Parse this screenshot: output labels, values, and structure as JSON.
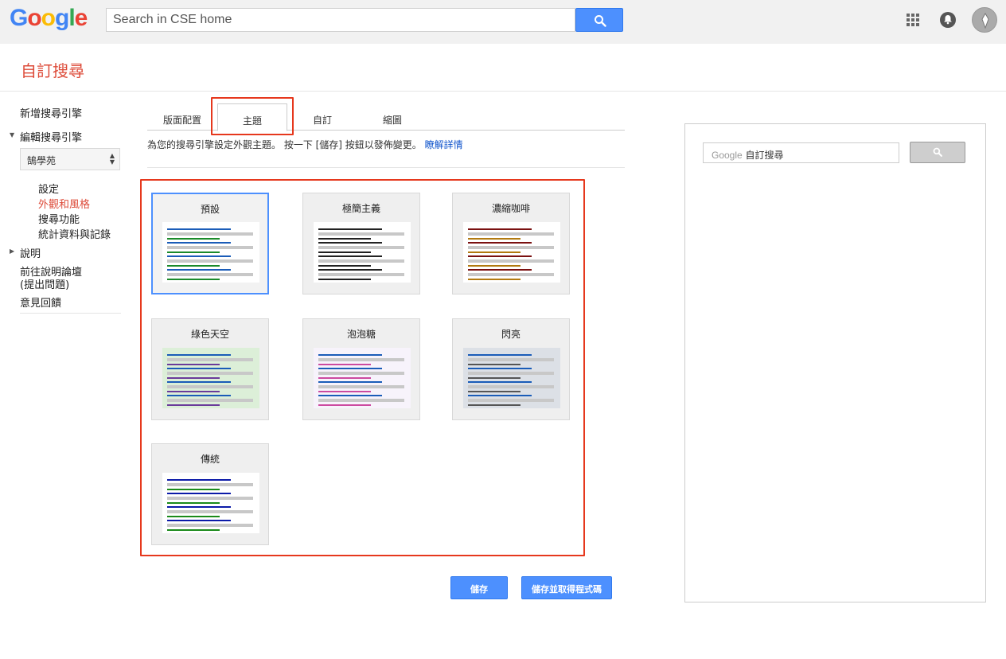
{
  "header": {
    "logo": [
      "G",
      "o",
      "o",
      "g",
      "l",
      "e"
    ],
    "logo_colors": [
      "#4285f4",
      "#ea4335",
      "#fbbc05",
      "#4285f4",
      "#34a853",
      "#ea4335"
    ],
    "search_value": "Search in CSE home",
    "icons": [
      "search-icon",
      "apps-grid-icon",
      "notifications-bell-icon",
      "account-avatar"
    ]
  },
  "page": {
    "title": "自訂搜尋"
  },
  "sidebar": {
    "new_engine": "新增搜尋引擎",
    "edit_engine": "編輯搜尋引擎",
    "selected_engine": "鵠學苑",
    "sub_items": [
      "設定",
      "外觀和風格",
      "搜尋功能",
      "統計資料與記錄"
    ],
    "active_sub_item": "外觀和風格",
    "help": "說明",
    "forum_line1": "前往說明論壇",
    "forum_line2": "(提出問題)",
    "feedback": "意見回饋"
  },
  "tabs": {
    "items": [
      "版面配置",
      "主題",
      "自訂",
      "縮圖"
    ],
    "active": "主題"
  },
  "description": {
    "text": "為您的搜尋引擎設定外觀主題。 按一下 [儲存] 按鈕以發佈變更。",
    "link": "瞭解詳情"
  },
  "themes": [
    {
      "name": "預設",
      "selected": true,
      "bg": "#ffffff",
      "title_color": "#1a5cb8",
      "url_color": "#1a8a2a"
    },
    {
      "name": "極簡主義",
      "selected": false,
      "bg": "#ffffff",
      "title_color": "#222222",
      "url_color": "#222222"
    },
    {
      "name": "濃縮咖啡",
      "selected": false,
      "bg": "#ffffff",
      "title_color": "#7a1010",
      "url_color": "#b27a10"
    },
    {
      "name": "綠色天空",
      "selected": false,
      "bg": "#dcefd8",
      "title_color": "#1a5cb8",
      "url_color": "#6a3a9a"
    },
    {
      "name": "泡泡糖",
      "selected": false,
      "bg": "#f7f3fb",
      "title_color": "#1a5cb8",
      "url_color": "#cc4aa0"
    },
    {
      "name": "閃亮",
      "selected": false,
      "bg": "#dce0e6",
      "title_color": "#1a5cb8",
      "url_color": "#555555"
    },
    {
      "name": "傳統",
      "selected": false,
      "bg": "#ffffff",
      "title_color": "#0b1aa8",
      "url_color": "#1a8a1a"
    }
  ],
  "buttons": {
    "save": "儲存",
    "save_get_code": "儲存並取得程式碼"
  },
  "preview": {
    "brand": "Google",
    "placeholder": "自訂搜尋"
  }
}
